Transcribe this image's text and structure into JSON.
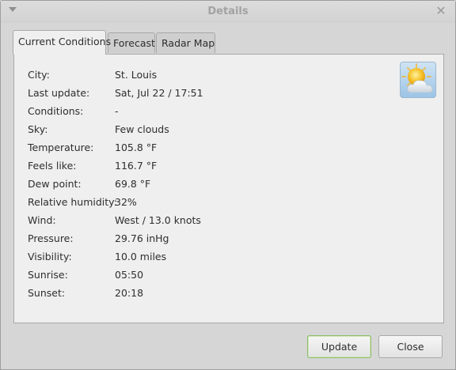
{
  "window": {
    "title": "Details",
    "close_glyph": "✕"
  },
  "tabs": [
    {
      "label": "Current Conditions",
      "active": true
    },
    {
      "label": "Forecast",
      "active": false
    },
    {
      "label": "Radar Map",
      "active": false
    }
  ],
  "conditions": {
    "icon": "few-clouds-icon",
    "rows": [
      {
        "label": "City:",
        "value": "St. Louis"
      },
      {
        "label": "Last update:",
        "value": "Sat, Jul 22 / 17:51"
      },
      {
        "label": "Conditions:",
        "value": "-"
      },
      {
        "label": "Sky:",
        "value": "Few clouds"
      },
      {
        "label": "Temperature:",
        "value": "105.8 °F"
      },
      {
        "label": "Feels like:",
        "value": "116.7 °F"
      },
      {
        "label": "Dew point:",
        "value": "69.8 °F"
      },
      {
        "label": "Relative humidity:",
        "value": "32%"
      },
      {
        "label": "Wind:",
        "value": "West / 13.0 knots"
      },
      {
        "label": "Pressure:",
        "value": "29.76 inHg"
      },
      {
        "label": "Visibility:",
        "value": "10.0 miles"
      },
      {
        "label": "Sunrise:",
        "value": "05:50"
      },
      {
        "label": "Sunset:",
        "value": "20:18"
      }
    ]
  },
  "buttons": {
    "update_label": "Update",
    "close_label": "Close"
  },
  "colors": {
    "default_button_border": "#8dbb6a",
    "panel_background": "#efefef",
    "window_background": "#d6d6d6"
  }
}
